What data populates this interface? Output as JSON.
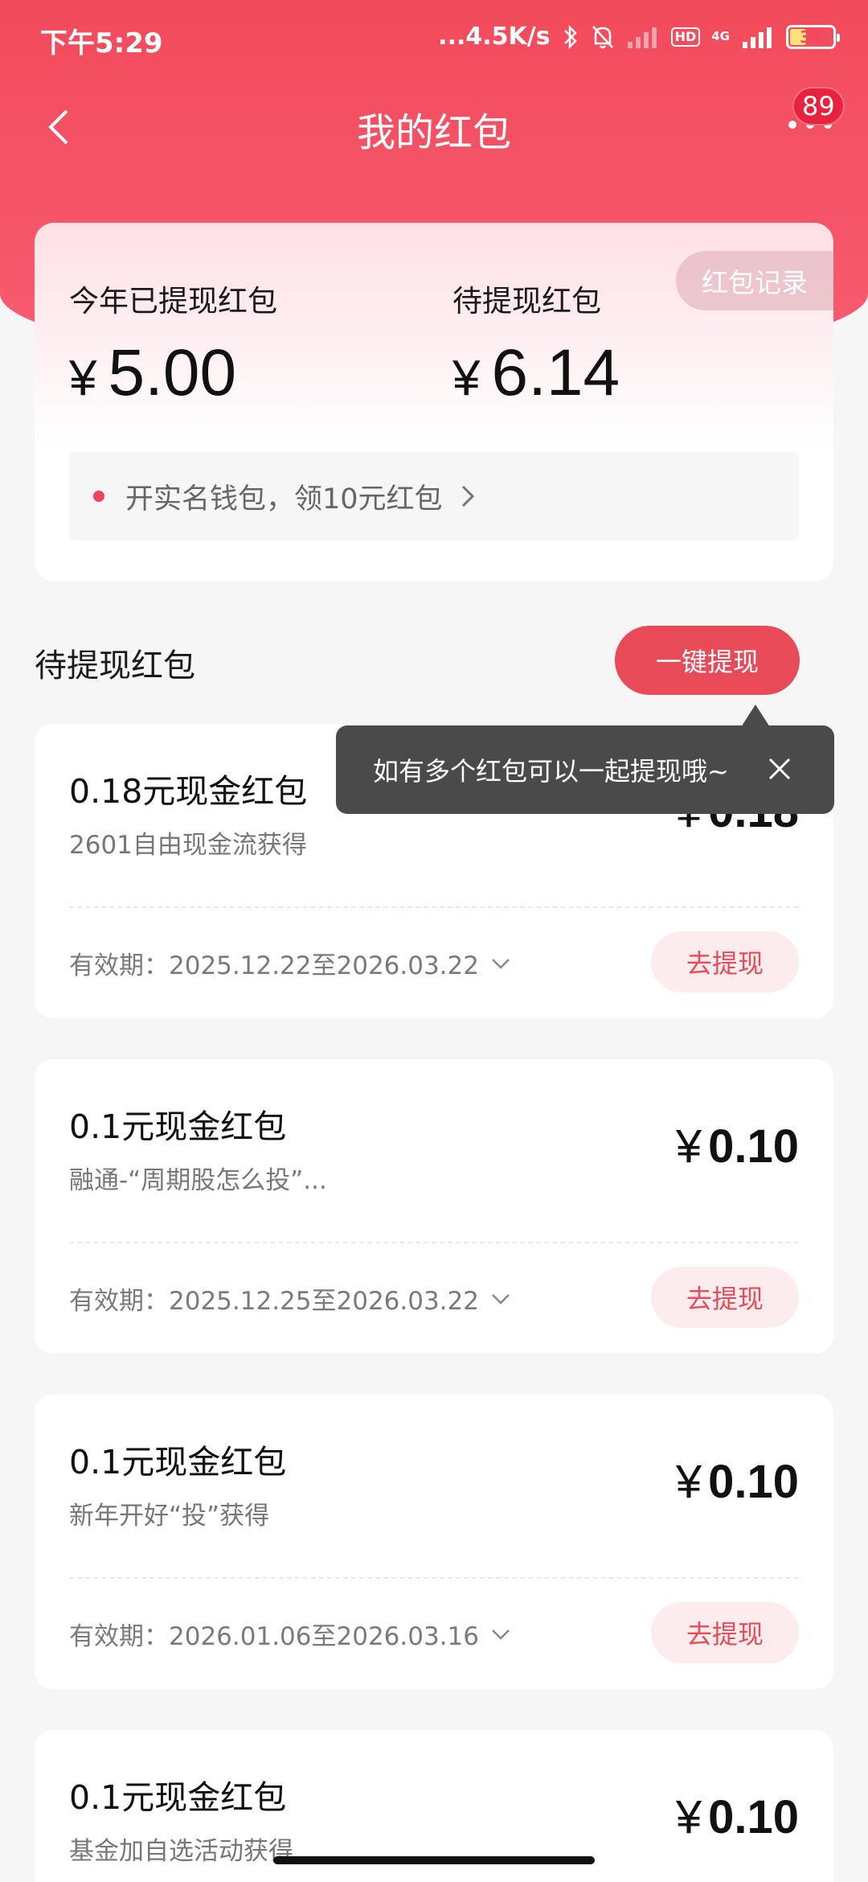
{
  "status_bar": {
    "time": "下午5:29",
    "net_speed": "...4.5K/s",
    "hd": "HD",
    "network": "4G",
    "battery_pct": "39",
    "battery_level": 0.39
  },
  "header": {
    "title": "我的红包",
    "badge_count": "89"
  },
  "summary": {
    "record_label": "红包记录",
    "withdrawn_label": "今年已提现红包",
    "withdrawn_currency": "¥",
    "withdrawn_amount": "5.00",
    "pending_label": "待提现红包",
    "pending_currency": "¥",
    "pending_amount": "6.14",
    "wallet_promo": "开实名钱包，领10元红包"
  },
  "section": {
    "title": "待提现红包",
    "withdraw_all_label": "一键提现"
  },
  "tooltip": {
    "text": "如有多个红包可以一起提现哦~"
  },
  "coupons": [
    {
      "title": "0.18元现金红包",
      "subtitle": "2601自由现金流获得",
      "currency": "¥",
      "amount": "0.18",
      "expiry": "有效期：2025.12.22至2026.03.22",
      "button": "去提现"
    },
    {
      "title": "0.1元现金红包",
      "subtitle": "融通-“周期股怎么投”...",
      "currency": "¥",
      "amount": "0.10",
      "expiry": "有效期：2025.12.25至2026.03.22",
      "button": "去提现"
    },
    {
      "title": "0.1元现金红包",
      "subtitle": "新年开好“投”获得",
      "currency": "¥",
      "amount": "0.10",
      "expiry": "有效期：2026.01.06至2026.03.16",
      "button": "去提现"
    },
    {
      "title": "0.1元现金红包",
      "subtitle": "基金加自选活动获得",
      "currency": "¥",
      "amount": "0.10"
    }
  ],
  "colors": {
    "brand_red": "#f24a5b",
    "button_red": "#e84a58",
    "tooltip_bg": "#4a4a4a"
  }
}
